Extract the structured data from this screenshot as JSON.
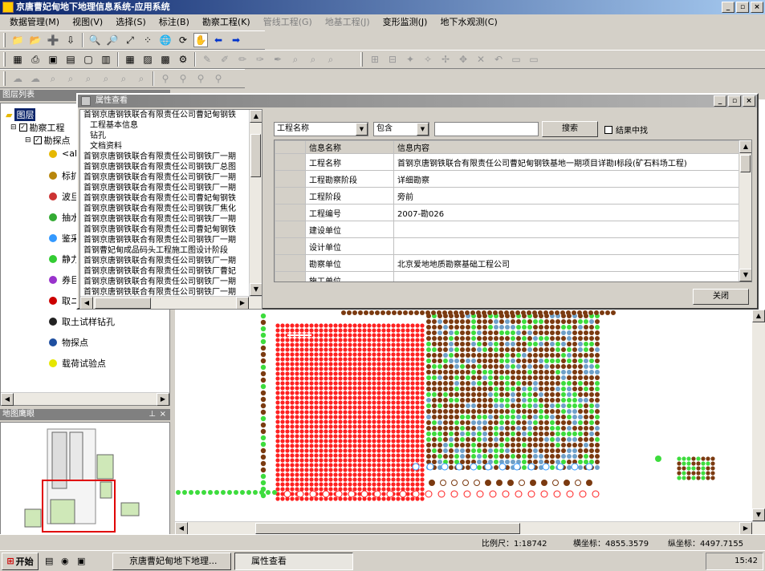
{
  "app": {
    "title": "京唐曹妃甸地下地理信息系统-应用系统"
  },
  "window_buttons": [
    "_",
    "▫",
    "×"
  ],
  "menu": [
    "数据管理(M)",
    "视图(V)",
    "选择(S)",
    "标注(B)",
    "勘察工程(K)",
    "管线工程(G)",
    "地基工程(J)",
    "变形监测(J)",
    "地下水观测(C)"
  ],
  "menu_disabled": [
    false,
    false,
    false,
    false,
    false,
    true,
    true,
    false,
    false
  ],
  "layer_panel": {
    "title": "图层列表",
    "root": "图层",
    "group": "勘察工程",
    "subgroup": "勘探点",
    "items": [
      {
        "label": "<al",
        "color": "#e6b800"
      },
      {
        "label": "标扩",
        "color": "#b8860b"
      },
      {
        "label": "波旦",
        "color": "#cc3333"
      },
      {
        "label": "抽水",
        "color": "#33aa33"
      },
      {
        "label": "鉴采",
        "color": "#3399ff"
      },
      {
        "label": "静力",
        "color": "#33cc33"
      },
      {
        "label": "券巨",
        "color": "#9933cc"
      },
      {
        "label": "取ニ",
        "color": "#cc0000"
      },
      {
        "label": "取土试样钻孔",
        "color": "#222222"
      },
      {
        "label": "物探点",
        "color": "#1f4fa0"
      },
      {
        "label": "载荷试验点",
        "color": "#e6e600"
      }
    ]
  },
  "overview_panel": {
    "title": "地图鹰眼"
  },
  "dialog": {
    "title": "属性查看",
    "tree_items": [
      "首钢京唐钢铁联合有限责任公司曹妃甸钢铁",
      "工程基本信息",
      "钻孔",
      "文档资料",
      "首钢京唐钢铁联合有限责任公司钢铁厂一期",
      "首钢京唐钢铁联合有限责任公司钢铁厂总图",
      "首钢京唐钢铁联合有限责任公司钢铁厂一期",
      "首钢京唐钢铁联合有限责任公司钢铁厂一期",
      "首钢京唐钢铁联合有限责任公司曹妃甸钢铁",
      "首钢京唐钢铁联合有限责任公司钢铁厂焦化",
      "首钢京唐钢铁联合有限责任公司钢铁厂一期",
      "首钢京唐钢铁联合有限责任公司曹妃甸钢铁",
      "首钢京唐钢铁联合有限责任公司钢铁厂一期",
      "首钢曹妃甸成品码头工程施工图设计阶段",
      "首钢京唐钢铁联合有限责任公司钢铁厂一期",
      "首钢京唐钢铁联合有限责任公司钢铁厂曹妃",
      "首钢京唐钢铁联合有限责任公司钢铁厂一期",
      "首钢京唐钢铁联合有限责任公司钢铁厂一期",
      "首钢京唐钢铁联合有限责任公司钢铁厂一期",
      "首钢京唐钢铁联合有限责任公司钢铁厂自备",
      "首钢京唐钢铁联合有限责任公司曹妃甸钢铁"
    ],
    "search_field": "工程名称",
    "search_op": "包含",
    "search_value": "",
    "search_button": "搜索",
    "filter_label": "结果中找",
    "grid_headers": [
      "信息名称",
      "信息内容"
    ],
    "grid_rows": [
      [
        "工程名称",
        "首钢京唐钢铁联合有限责任公司曹妃甸钢铁基地一期项目详勘Ⅰ标段(矿石料场工程)"
      ],
      [
        "工程勘察阶段",
        "详细勘察"
      ],
      [
        "工程阶段",
        "旁前"
      ],
      [
        "工程编号",
        "2007-勘026"
      ],
      [
        "建设单位",
        ""
      ],
      [
        "设计单位",
        ""
      ],
      [
        "勘察单位",
        "北京爱地地质勘察基础工程公司"
      ],
      [
        "施工单位",
        ""
      ]
    ],
    "close_button": "关闭"
  },
  "status": {
    "scale": "比例尺：1:18742",
    "x": "横坐标：4855.3579",
    "y": "纵坐标：4497.7155"
  },
  "taskbar": {
    "start": "开始",
    "tasks": [
      "京唐曹妃甸地下地理...",
      "属性查看"
    ],
    "clock": "15:42"
  }
}
